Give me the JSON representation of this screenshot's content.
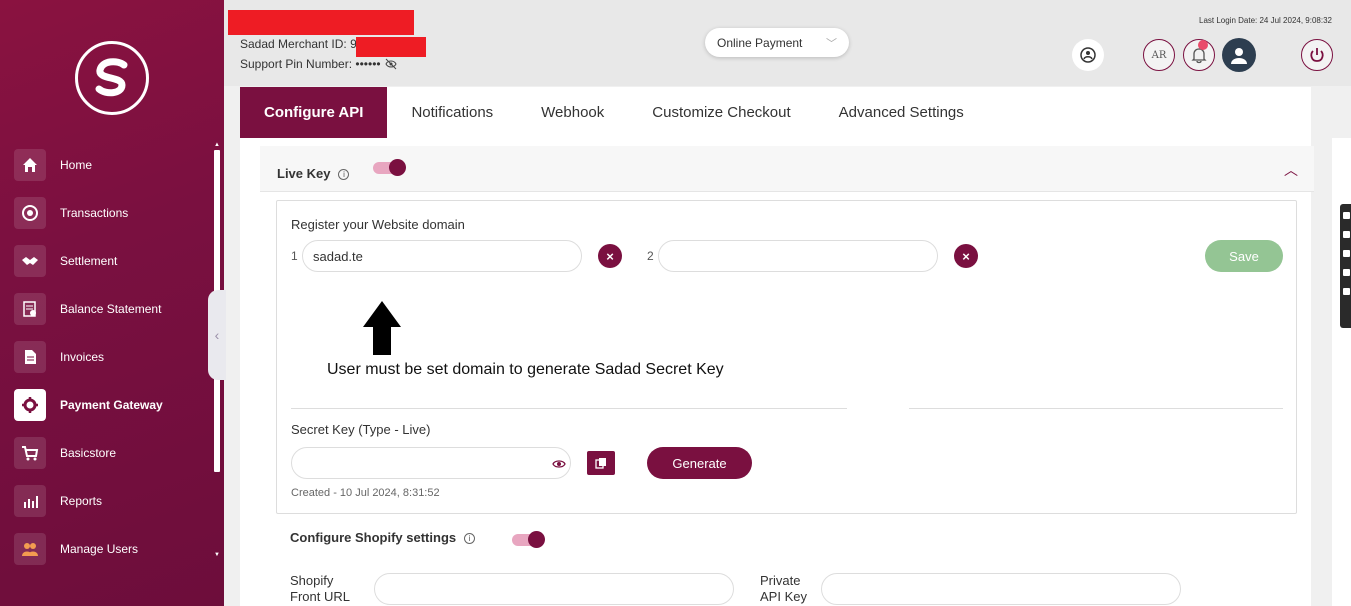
{
  "header": {
    "merchant_id_label": "Sadad Merchant ID: ",
    "merchant_id_fragment": "9",
    "support_pin_label": "Support Pin Number: ••••••",
    "payment_select": "Online Payment",
    "last_login": "Last Login Date: 24 Jul 2024, 9:08:32",
    "lang_button": "AR"
  },
  "sidebar": {
    "items": [
      {
        "label": "Home",
        "icon": "home-icon"
      },
      {
        "label": "Transactions",
        "icon": "transactions-icon"
      },
      {
        "label": "Settlement",
        "icon": "handshake-icon"
      },
      {
        "label": "Balance Statement",
        "icon": "statement-icon"
      },
      {
        "label": "Invoices",
        "icon": "invoice-icon"
      },
      {
        "label": "Payment Gateway",
        "icon": "gear-icon",
        "active": true
      },
      {
        "label": "Basicstore",
        "icon": "cart-icon"
      },
      {
        "label": "Reports",
        "icon": "chart-icon"
      },
      {
        "label": "Manage Users",
        "icon": "users-icon"
      }
    ]
  },
  "tabs": [
    "Configure API",
    "Notifications",
    "Webhook",
    "Customize Checkout",
    "Advanced Settings"
  ],
  "live_key": {
    "label": "Live Key",
    "enabled": true
  },
  "domains": {
    "label": "Register your Website domain",
    "num1": "1",
    "num2": "2",
    "domain1_value": "sadad.te",
    "domain2_value": "",
    "save_label": "Save"
  },
  "annotation": "User must be set domain to generate Sadad Secret Key",
  "secret_key": {
    "label": "Secret Key (Type - Live)",
    "value": "",
    "generate_label": "Generate",
    "created": "Created - 10 Jul 2024, 8:31:52"
  },
  "shopify": {
    "label": "Configure Shopify settings",
    "enabled": true,
    "front_url_label_1": "Shopify",
    "front_url_label_2": "Front URL",
    "private_key_label_1": "Private",
    "private_key_label_2": "API Key"
  },
  "colors": {
    "brand": "#7a1040",
    "save_disabled": "#94c594",
    "redaction": "#ee1c24"
  }
}
